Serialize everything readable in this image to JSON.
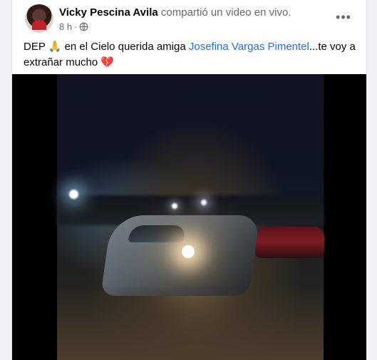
{
  "post": {
    "author": "Vicky Pescina Avila",
    "action": "compartió un video en vivo.",
    "time": "8 h",
    "dot": "·",
    "more_label": "•••",
    "message_start": "DEP 🙏 en el Cielo querida amiga",
    "mention": "Josefina Vargas Pimentel",
    "message_end": "...te voy a extrañar mucho 💔"
  },
  "icons": {
    "avatar": "profile-photo",
    "globe": "globe-icon",
    "more": "more-options-icon"
  },
  "colors": {
    "mention": "#216fdb",
    "author": "#050505",
    "secondary": "#65676b"
  }
}
